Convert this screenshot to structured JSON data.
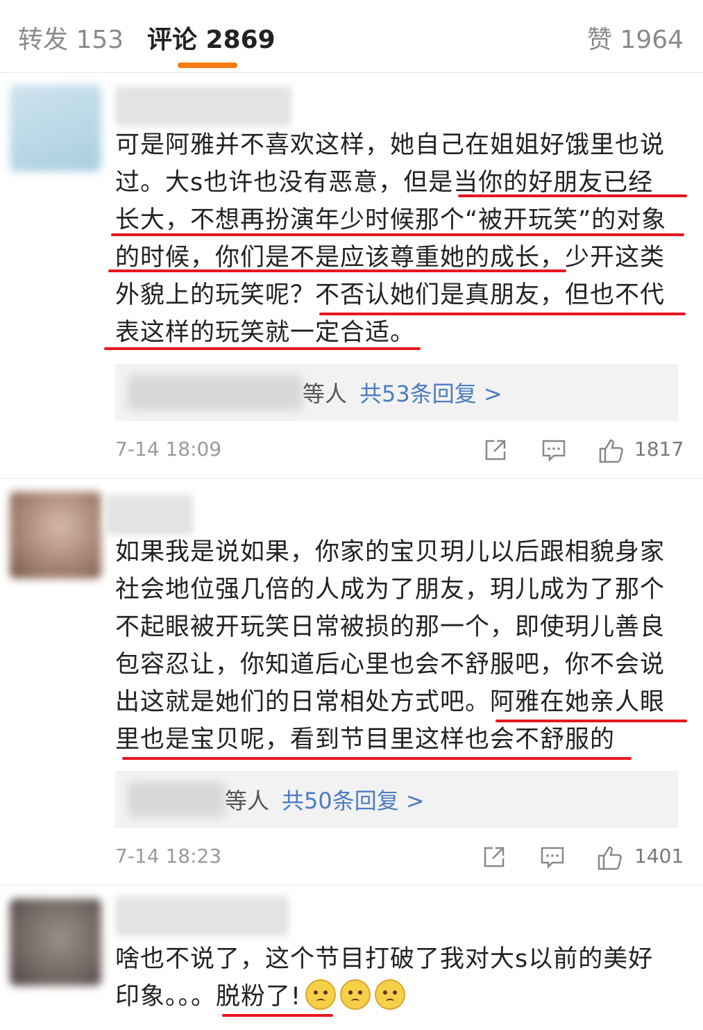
{
  "tabs": {
    "repost": "转发 153",
    "comments": "评论 2869",
    "likes": "赞 1964",
    "accent_color": "#f77b12"
  },
  "comments": [
    {
      "lines": [
        "可是阿雅并不喜欢这样，她自己在姐姐好饿里也说",
        "过。大s也许也没有恶意，但是当你的好朋友已经",
        "长大，不想再扮演年少时候那个“被开玩笑”的对象",
        "的时候，你们是不是应该尊重她的成长，少开这类",
        "外貌上的玩笑呢？不否认她们是真朋友，但也不代",
        "表这样的玩笑就一定合适。"
      ],
      "reply_by": "等人",
      "reply_count": "共53条回复 >",
      "time": "7-14 18:09",
      "likes": "1817"
    },
    {
      "lines": [
        "如果我是说如果，你家的宝贝玥儿以后跟相貌身家",
        "社会地位强几倍的人成为了朋友，玥儿成为了那个",
        "不起眼被开玩笑日常被损的那一个，即使玥儿善良",
        "包容忍让，你知道后心里也会不舒服吧，你不会说",
        "出这就是她们的日常相处方式吧。阿雅在她亲人眼",
        "里也是宝贝呢，看到节目里这样也会不舒服的"
      ],
      "reply_by": "等人",
      "reply_count": "共50条回复 >",
      "time": "7-14 18:23",
      "likes": "1401"
    },
    {
      "lines": [
        "啥也不说了，这个节目打破了我对大s以前的美好",
        "印象。。。脱粉了!"
      ],
      "emoji_name": "thinking-face-icon"
    }
  ],
  "underline_color": "#e8161f",
  "reply_link_color": "#4b7cc1"
}
